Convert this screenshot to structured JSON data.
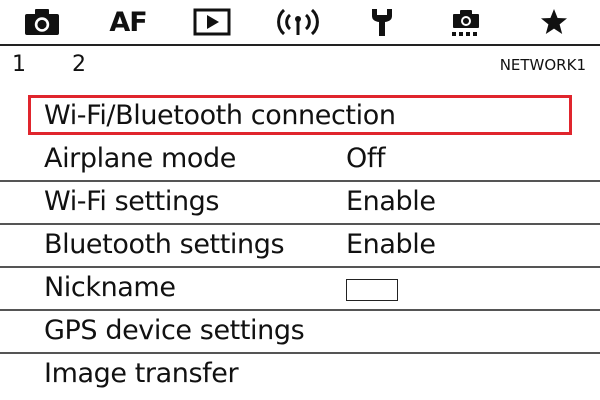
{
  "tabs": [
    {
      "name": "shooting",
      "icon": "camera-icon"
    },
    {
      "name": "af",
      "label": "AF"
    },
    {
      "name": "playback",
      "icon": "play-icon"
    },
    {
      "name": "wireless",
      "icon": "wireless-icon"
    },
    {
      "name": "setup",
      "icon": "wrench-icon"
    },
    {
      "name": "custom-functions",
      "icon": "custom-functions-icon"
    },
    {
      "name": "my-menu",
      "icon": "star-icon"
    }
  ],
  "active_tab": "wireless",
  "pages": [
    "1",
    "2"
  ],
  "page_name": "NETWORK1",
  "menu": [
    {
      "label": "Wi-Fi/Bluetooth connection",
      "value": "",
      "selected": true
    },
    {
      "label": "Airplane mode",
      "value": "Off"
    },
    {
      "label": "Wi-Fi settings",
      "value": "Enable"
    },
    {
      "label": "Bluetooth settings",
      "value": "Enable"
    },
    {
      "label": "Nickname",
      "value": ""
    },
    {
      "label": "GPS device settings",
      "value": ""
    },
    {
      "label": "Image transfer",
      "value": ""
    }
  ],
  "colors": {
    "selection": "#e0252d",
    "text": "#111111",
    "divider": "#555555"
  }
}
